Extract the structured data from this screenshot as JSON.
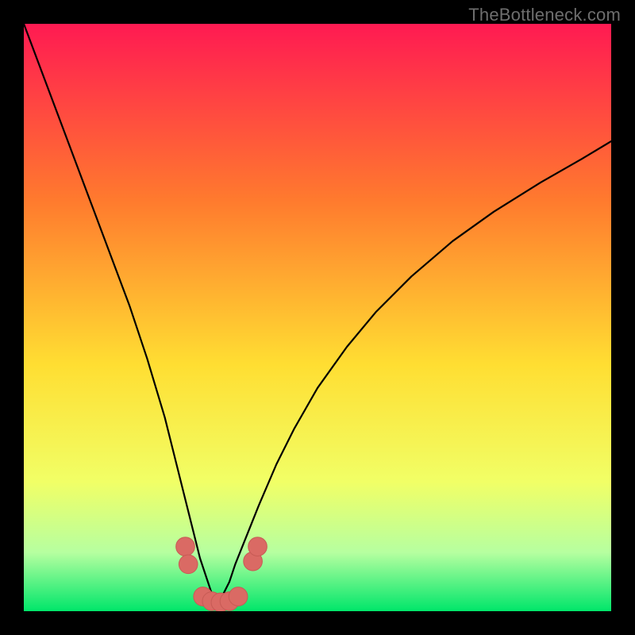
{
  "watermark": "TheBottleneck.com",
  "colors": {
    "bg": "#000000",
    "grad_top": "#ff1a52",
    "grad_upper_mid": "#ff7a2e",
    "grad_mid": "#ffde32",
    "grad_lower_mid": "#f1ff66",
    "grad_low": "#b6ffa0",
    "grad_bottom": "#00e66a",
    "curve": "#000000",
    "marker_fill": "#da6a64",
    "marker_stroke": "#c75b55"
  },
  "chart_data": {
    "type": "line",
    "title": "",
    "xlabel": "",
    "ylabel": "",
    "xlim": [
      0,
      100
    ],
    "ylim": [
      0,
      100
    ],
    "curve_minimum_x": 33,
    "series": [
      {
        "name": "bottleneck-curve",
        "x": [
          0,
          3,
          6,
          9,
          12,
          15,
          18,
          21,
          24,
          26,
          28,
          30,
          31,
          32,
          33,
          34,
          35,
          36,
          38,
          40,
          43,
          46,
          50,
          55,
          60,
          66,
          73,
          80,
          88,
          95,
          100
        ],
        "y": [
          100,
          92,
          84,
          76,
          68,
          60,
          52,
          43,
          33,
          25,
          17,
          9,
          6,
          3,
          2,
          3,
          5,
          8,
          13,
          18,
          25,
          31,
          38,
          45,
          51,
          57,
          63,
          68,
          73,
          77,
          80
        ]
      }
    ],
    "markers": {
      "name": "highlight-points",
      "points": [
        {
          "x": 27.5,
          "y": 11
        },
        {
          "x": 28.0,
          "y": 8
        },
        {
          "x": 30.5,
          "y": 2.5
        },
        {
          "x": 32.0,
          "y": 1.7
        },
        {
          "x": 33.5,
          "y": 1.5
        },
        {
          "x": 35.0,
          "y": 1.7
        },
        {
          "x": 36.5,
          "y": 2.5
        },
        {
          "x": 39.0,
          "y": 8.5
        },
        {
          "x": 39.8,
          "y": 11
        }
      ],
      "radius": 1.6
    }
  }
}
